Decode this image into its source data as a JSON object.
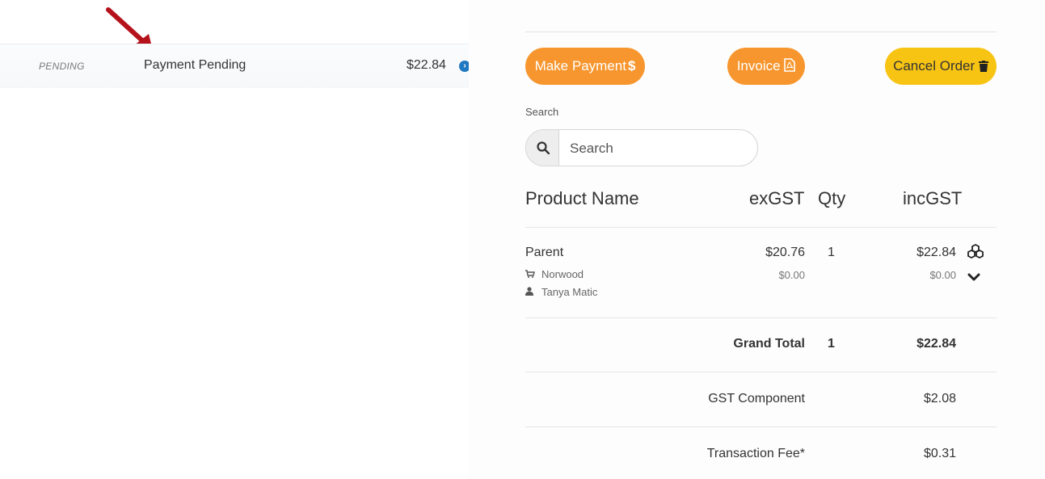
{
  "order_row": {
    "status_tag": "PENDING",
    "status_text": "Payment Pending",
    "amount": "$22.84",
    "chevron_icon": "chevron-circle-right-icon"
  },
  "buttons": {
    "make_payment": "Make Payment",
    "make_payment_icon": "$",
    "invoice": "Invoice",
    "invoice_icon": "pdf-file-icon",
    "cancel_order": "Cancel Order",
    "cancel_icon": "trash-icon"
  },
  "search": {
    "label": "Search",
    "placeholder": "Search",
    "icon": "search-icon"
  },
  "table": {
    "headers": {
      "product_name": "Product Name",
      "ex_gst": "exGST",
      "qty": "Qty",
      "inc_gst": "incGST"
    },
    "rows": [
      {
        "name": "Parent",
        "location": "Norwood",
        "location_icon": "cart-icon",
        "person": "Tanya Matic",
        "person_icon": "user-icon",
        "ex_gst": "$20.76",
        "ex_gst_sub": "$0.00",
        "qty": "1",
        "inc_gst": "$22.84",
        "inc_gst_sub": "$0.00"
      }
    ]
  },
  "totals": {
    "grand_total_label": "Grand Total",
    "grand_total_qty": "1",
    "grand_total_value": "$22.84",
    "gst_label": "GST Component",
    "gst_value": "$2.08",
    "fee_label": "Transaction Fee*",
    "fee_value": "$0.31"
  },
  "colors": {
    "orange": "#f7962e",
    "yellow": "#f8c414",
    "blue": "#1f78c1",
    "arrow_red": "#b5121b"
  }
}
